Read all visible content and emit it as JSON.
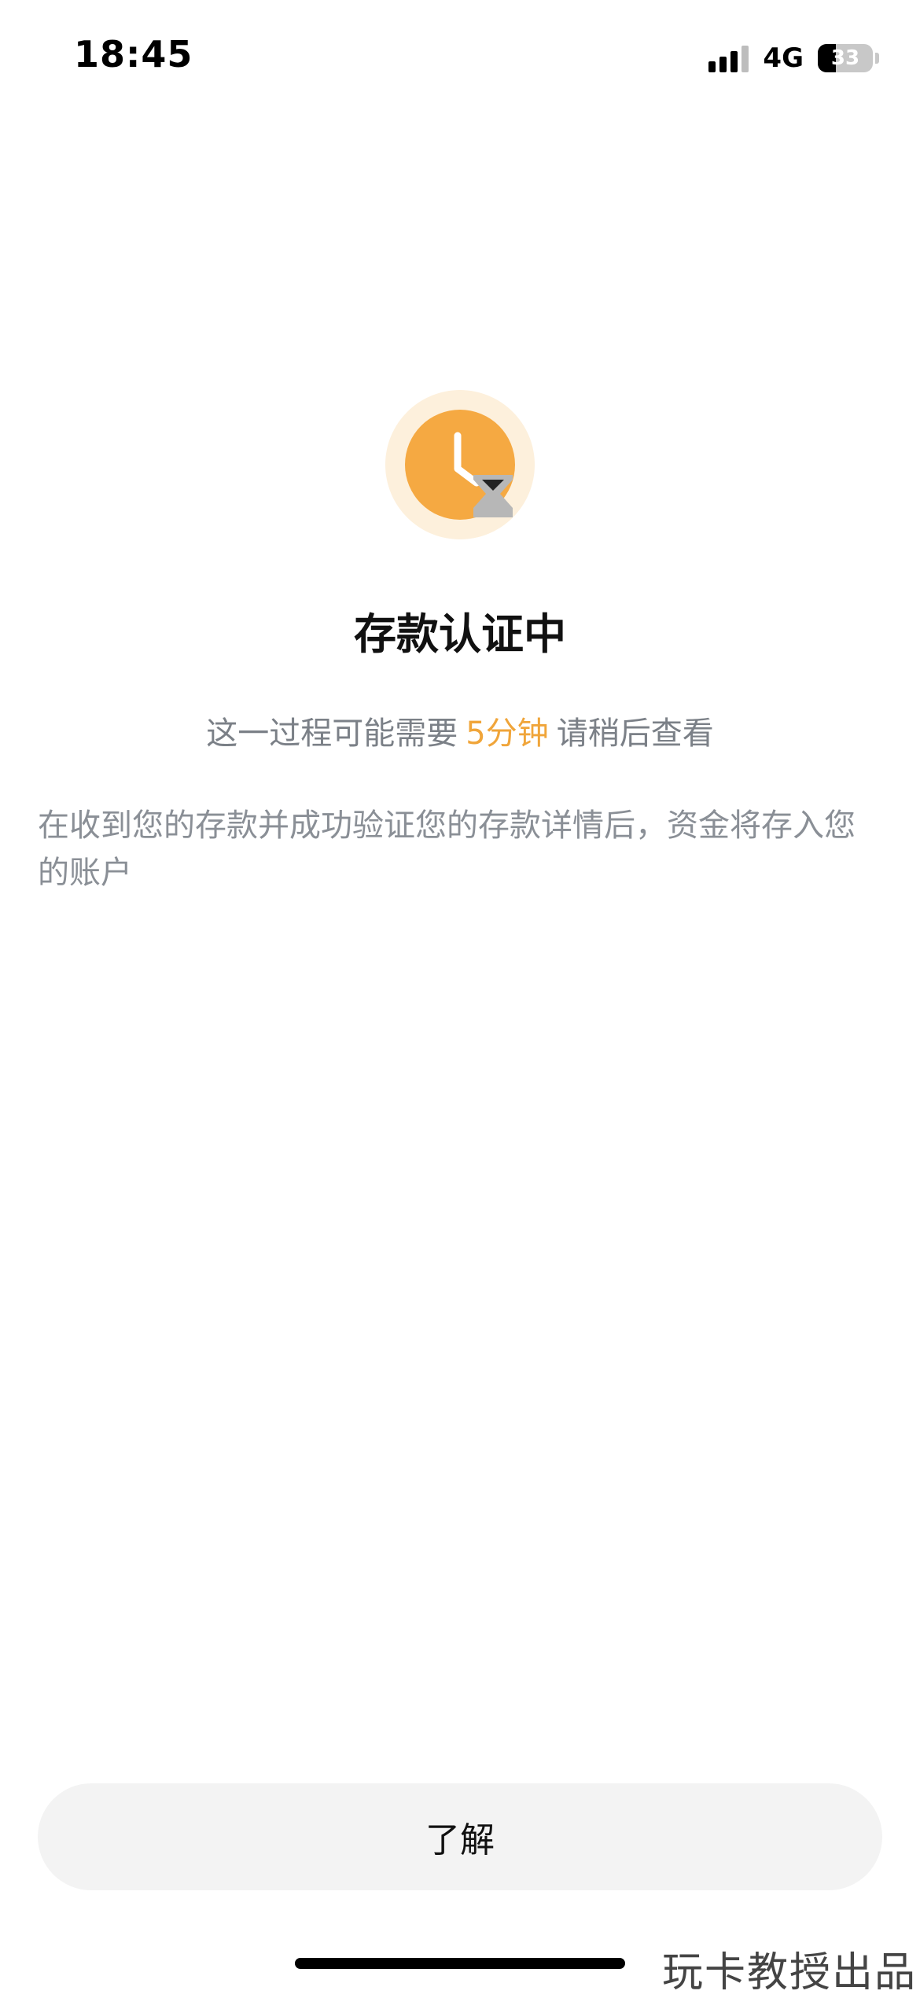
{
  "status_bar": {
    "time": "18:45",
    "network": "4G",
    "battery_level": "33",
    "battery_fraction": 0.33
  },
  "hero": {
    "icon": "clock-hourglass-icon",
    "colors": {
      "halo": "#fdf0dc",
      "clock_face": "#f5a942",
      "clock_hands": "#ffffff",
      "hourglass": "#b7b7b7",
      "hourglass_sand": "#222222"
    }
  },
  "content": {
    "title": "存款认证中",
    "subtitle_prefix": "这一过程可能需要",
    "subtitle_highlight": "5分钟",
    "subtitle_suffix": "请稍后查看",
    "description": "在收到您的存款并成功验证您的存款详情后，资金将存入您的账户",
    "highlight_color": "#f0a53a"
  },
  "actions": {
    "acknowledge_label": "了解"
  },
  "watermark": {
    "text": "玩卡教授出品"
  }
}
